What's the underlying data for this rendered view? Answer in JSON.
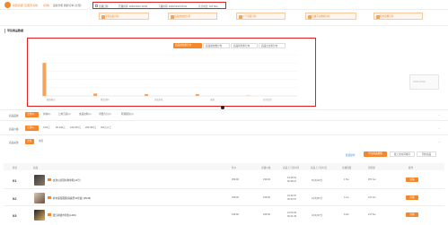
{
  "header": {
    "shop_name": "婉姐商铺门店服务系统",
    "switch_label": "[切换]",
    "nav_item_1": "运营分析",
    "nav_item_2": "我的订单 (全部)",
    "filter_box": {
      "item_1": "直播日期",
      "item_2": "开播时间: 2020/12/22 19:00",
      "item_3": "下播时间: 2020/12/23 05:04",
      "item_4": "共计时长: 10h 09m"
    }
  },
  "tabs": [
    {
      "label": "带货商品分析"
    },
    {
      "label": "商品成交额分析"
    },
    {
      "label": "人气流量分析"
    },
    {
      "label": "直播互动数据分析"
    },
    {
      "label": "粉丝画像分析"
    }
  ],
  "section_title": "带货商品数据",
  "chart_toggle": [
    "商品成交额分布",
    "商品成交数分布",
    "商品转化率分布",
    "商品点击率分布"
  ],
  "chart_data": {
    "type": "bar",
    "categories": [
      "服饰鞋包",
      "食品饮料",
      "美妆护肤",
      "母婴",
      "日用百货"
    ],
    "values": [
      96,
      7,
      5,
      5,
      1
    ],
    "ylim": [
      0,
      120
    ]
  },
  "chart_side_label": "VIEW MORE",
  "filters": {
    "category": {
      "label": "商品品类:",
      "options": [
        "全部(1)",
        "护肤(1)",
        "日用百货(1)",
        "食品饮料(1)",
        "母婴育儿(1)",
        "鞋靴箱包(1)"
      ]
    },
    "price": {
      "label": "商品价格:",
      "options": [
        "全部(1)",
        "0-50元",
        "50-100元",
        "100-200元",
        "200-300元",
        "300元以上"
      ]
    },
    "source": {
      "label": "商品来源:",
      "options": [
        "全部",
        "淘宝"
      ]
    }
  },
  "table_actions": [
    "批量操作",
    "导出商品数据",
    "按上架时间排序",
    "同步商品"
  ],
  "table": {
    "headers": [
      "排名",
      "商品",
      "售价",
      "直播价格",
      "商品上下架时间",
      "商品上下架时长",
      "直播销量",
      "销售额",
      "操作"
    ],
    "rows": [
      {
        "rank": "01",
        "title": "女款小皮鞋时尚单鞋(14号)",
        "price": "¥59.90",
        "live_price": "¥39.90",
        "time_on": "19:16:51",
        "time_off": "00:38:21",
        "duration": "5小时22分",
        "sales": "1.5w",
        "revenue": "¥57.4w",
        "action": "详情"
      },
      {
        "rank": "02",
        "title": "补水保湿面膜(清爽型10片装) (45/16)",
        "price": "¥59.90",
        "live_price": "¥26.90",
        "time_on": "19:42:07",
        "time_off": "00:33:57",
        "duration": "4小时51分",
        "sales": "1.1w",
        "revenue": "¥17.2w",
        "action": "详情"
      },
      {
        "rank": "03",
        "title": "婴儿棉柔巾新生(L403)",
        "price": "¥39.90",
        "live_price": "¥26.90",
        "time_on": "21:04:29",
        "time_off": "00:41:46",
        "duration": "3小时37分",
        "sales": "6.6w",
        "revenue": "¥17.6w",
        "action": "详情"
      }
    ]
  },
  "colors": {
    "accent": "#f5862a",
    "highlight_border": "#e02020",
    "bar": "#f5a35c"
  },
  "icons": [
    "logo-icon",
    "calendar-icon",
    "chart-icon",
    "chevron-down-icon",
    "arrow-right-icon"
  ]
}
